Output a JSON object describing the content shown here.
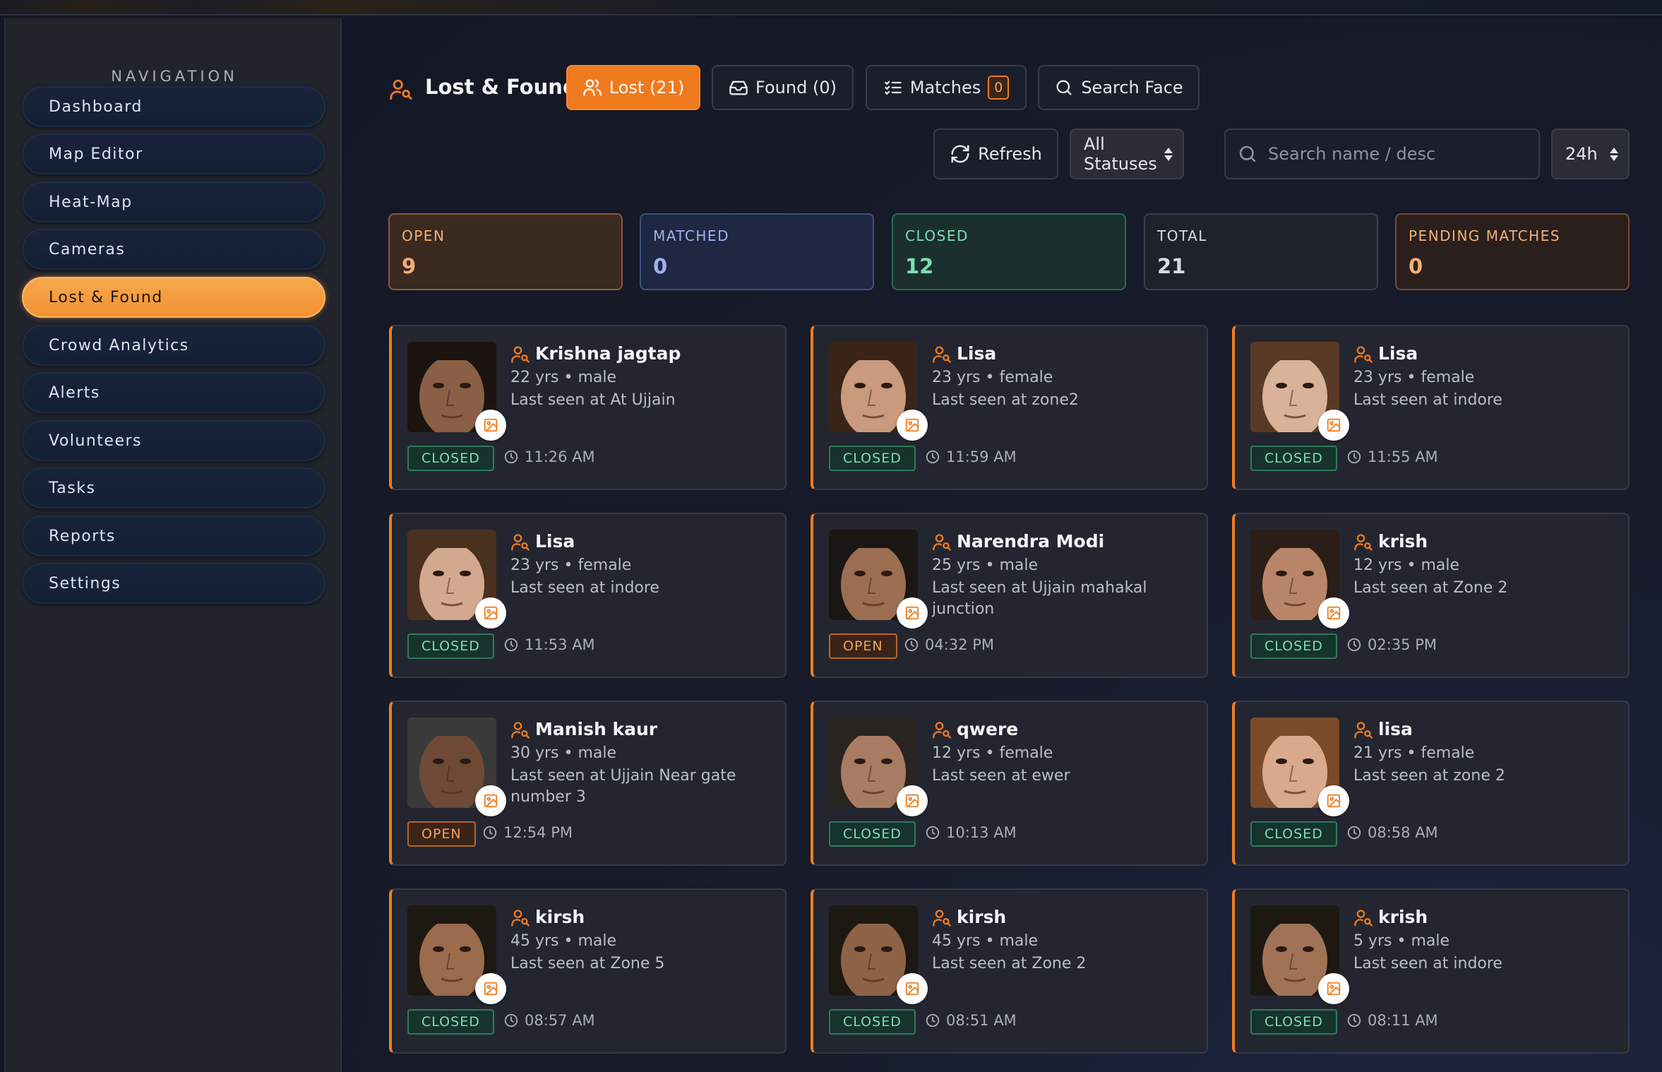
{
  "sidebar": {
    "title": "NAVIGATION",
    "items": [
      {
        "label": "Dashboard"
      },
      {
        "label": "Map Editor"
      },
      {
        "label": "Heat-Map"
      },
      {
        "label": "Cameras"
      },
      {
        "label": "Lost & Found",
        "active": true
      },
      {
        "label": "Crowd Analytics"
      },
      {
        "label": "Alerts"
      },
      {
        "label": "Volunteers"
      },
      {
        "label": "Tasks"
      },
      {
        "label": "Reports"
      },
      {
        "label": "Settings"
      }
    ]
  },
  "header": {
    "title": "Lost & Found",
    "tabs": {
      "lost": "Lost (21)",
      "found": "Found (0)",
      "matches": "Matches",
      "matches_count": "0",
      "search_face": "Search Face"
    }
  },
  "controls": {
    "refresh": "Refresh",
    "status_filter": "All Statuses",
    "search_placeholder": "Search name / desc",
    "time_range": "24h"
  },
  "stats": {
    "open": {
      "label": "OPEN",
      "value": "9"
    },
    "matched": {
      "label": "MATCHED",
      "value": "0"
    },
    "closed": {
      "label": "CLOSED",
      "value": "12"
    },
    "total": {
      "label": "TOTAL",
      "value": "21"
    },
    "pending": {
      "label": "PENDING MATCHES",
      "value": "0"
    }
  },
  "cards": [
    {
      "name": "Krishna jagtap",
      "meta": "22 yrs • male",
      "seen": "Last seen at At Ujjain",
      "status": "CLOSED",
      "time": "11:26 AM"
    },
    {
      "name": "Lisa",
      "meta": "23 yrs • female",
      "seen": "Last seen at zone2",
      "status": "CLOSED",
      "time": "11:59 AM"
    },
    {
      "name": "Lisa",
      "meta": "23 yrs • female",
      "seen": "Last seen at indore",
      "status": "CLOSED",
      "time": "11:55 AM"
    },
    {
      "name": "Lisa",
      "meta": "23 yrs • female",
      "seen": "Last seen at indore",
      "status": "CLOSED",
      "time": "11:53 AM"
    },
    {
      "name": "Narendra Modi",
      "meta": "25 yrs • male",
      "seen": "Last seen at Ujjain mahakal junction",
      "status": "OPEN",
      "time": "04:32 PM"
    },
    {
      "name": "krish",
      "meta": "12 yrs • male",
      "seen": "Last seen at Zone 2",
      "status": "CLOSED",
      "time": "02:35 PM"
    },
    {
      "name": "Manish kaur",
      "meta": "30 yrs • male",
      "seen": "Last seen at Ujjain Near gate number 3",
      "status": "OPEN",
      "time": "12:54 PM"
    },
    {
      "name": "qwere",
      "meta": "12 yrs • female",
      "seen": "Last seen at ewer",
      "status": "CLOSED",
      "time": "10:13 AM"
    },
    {
      "name": "lisa",
      "meta": "21 yrs • female",
      "seen": "Last seen at zone 2",
      "status": "CLOSED",
      "time": "08:58 AM"
    },
    {
      "name": "kirsh",
      "meta": "45 yrs • male",
      "seen": "Last seen at Zone 5",
      "status": "CLOSED",
      "time": "08:57 AM"
    },
    {
      "name": "kirsh",
      "meta": "45 yrs • male",
      "seen": "Last seen at Zone 2",
      "status": "CLOSED",
      "time": "08:51 AM"
    },
    {
      "name": "krish",
      "meta": "5 yrs • male",
      "seen": "Last seen at indore",
      "status": "CLOSED",
      "time": "08:11 AM"
    }
  ],
  "colors": {
    "accent": "#f07a1e",
    "closed": "#7ddcb2",
    "open": "#f5a15a"
  }
}
